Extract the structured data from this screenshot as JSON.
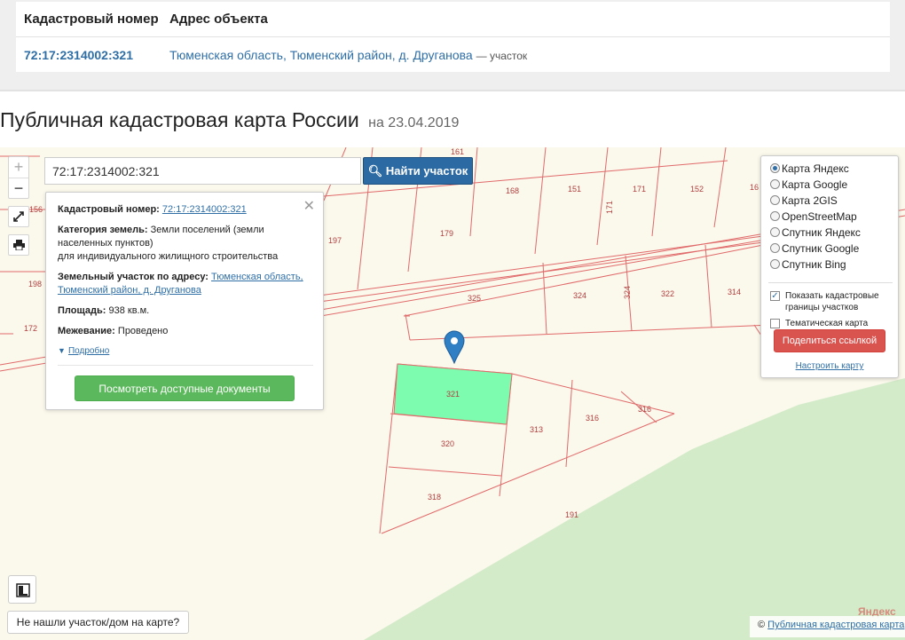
{
  "table": {
    "col1": "Кадастровый номер",
    "col2": "Адрес объекта",
    "rows": [
      {
        "cad_number": "72:17:2314002:321",
        "address": "Тюменская область, Тюменский район, д. Друганова",
        "suffix": "— участок"
      }
    ]
  },
  "title": {
    "text": "Публичная кадастровая карта России",
    "date": "на 23.04.2019"
  },
  "map": {
    "zoom_in": "+",
    "zoom_out": "−",
    "search_value": "72:17:2314002:321",
    "search_button": "Найти участок",
    "parcel_labels": [
      "161",
      "168",
      "151",
      "171",
      "152",
      "16",
      "156",
      "197",
      "179",
      "171",
      "198",
      "325",
      "324",
      "324",
      "322",
      "314",
      "172",
      "321",
      "313",
      "316",
      "316",
      "320",
      "318",
      "191"
    ],
    "highlight_color": "#7dfcaf",
    "parcel_line_color": "#e06a6a"
  },
  "info": {
    "cad_label": "Кадастровый номер:",
    "cad_value": "72:17:2314002:321",
    "category_label": "Категория земель:",
    "category_value": "Земли поселений (земли населенных пунктов)",
    "category_use": "для индивидуального жилищного строительства",
    "address_label": "Земельный участок по адресу:",
    "address_value": "Тюменская область, Тюменский район, д. Друганова",
    "area_label": "Площадь:",
    "area_value": "938 кв.м.",
    "survey_label": "Межевание:",
    "survey_value": "Проведено",
    "more": "Подробно",
    "docs_button": "Посмотреть доступные документы"
  },
  "layers": {
    "options": [
      "Карта Яндекс",
      "Карта Google",
      "Карта 2GIS",
      "OpenStreetMap",
      "Спутник Яндекс",
      "Спутник Google",
      "Спутник Bing"
    ],
    "selected": "Карта Яндекс",
    "show_boundaries": "Показать кадастровые границы участков",
    "thematic": "Тематическая карта",
    "share_button": "Поделиться ссылкой",
    "configure": "Настроить карту"
  },
  "bottom": {
    "not_found": "Не нашли участок/дом на карте?",
    "copyright_symbol": "©",
    "copyright_link": "Публичная кадастровая карта",
    "yandex": "Яндекс"
  }
}
